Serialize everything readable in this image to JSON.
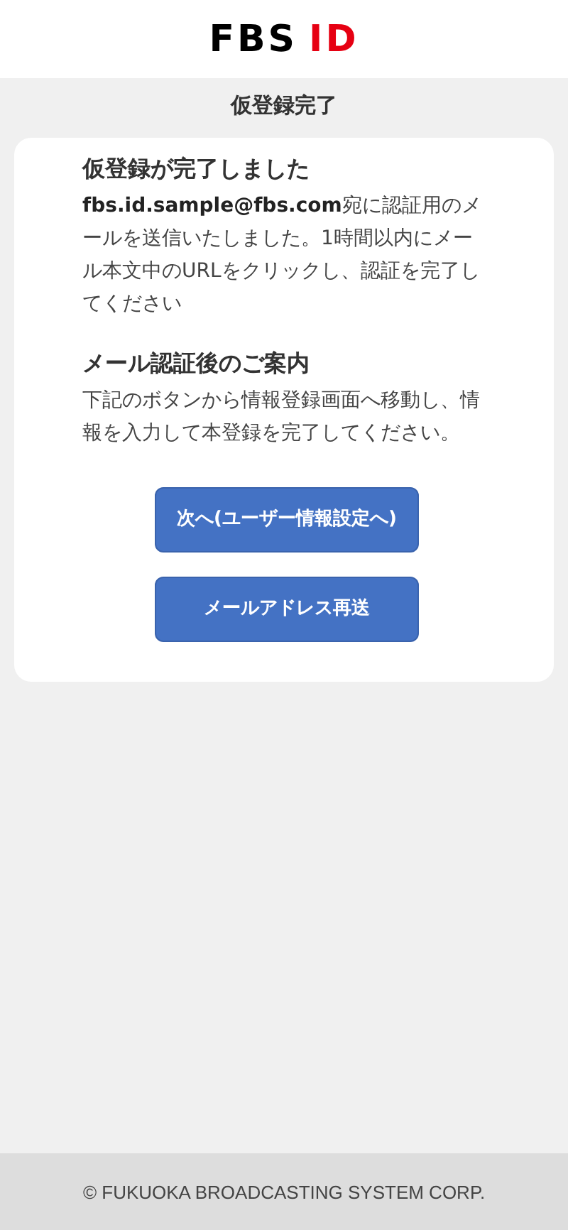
{
  "header": {
    "logo": {
      "main": "FBS",
      "accent": "ID"
    }
  },
  "page_title": "仮登録完了",
  "card": {
    "sections": [
      {
        "heading": "仮登録が完了しました",
        "body": "**fbs.id.sample@fbs.com**宛に認証用のメールを送信いたしました。1時間以内にメール本文中のURLをクリックし、認証を完了してください"
      },
      {
        "heading": "メール認証後のご案内",
        "body": "下記のボタンから情報登録画面へ移動し、情報を入力して本登録を完了してください。"
      }
    ],
    "buttons": [
      "次へ(ユーザー情報設定へ)",
      "メールアドレス再送"
    ]
  },
  "footer": "© FUKUOKA BROADCASTING SYSTEM CORP."
}
